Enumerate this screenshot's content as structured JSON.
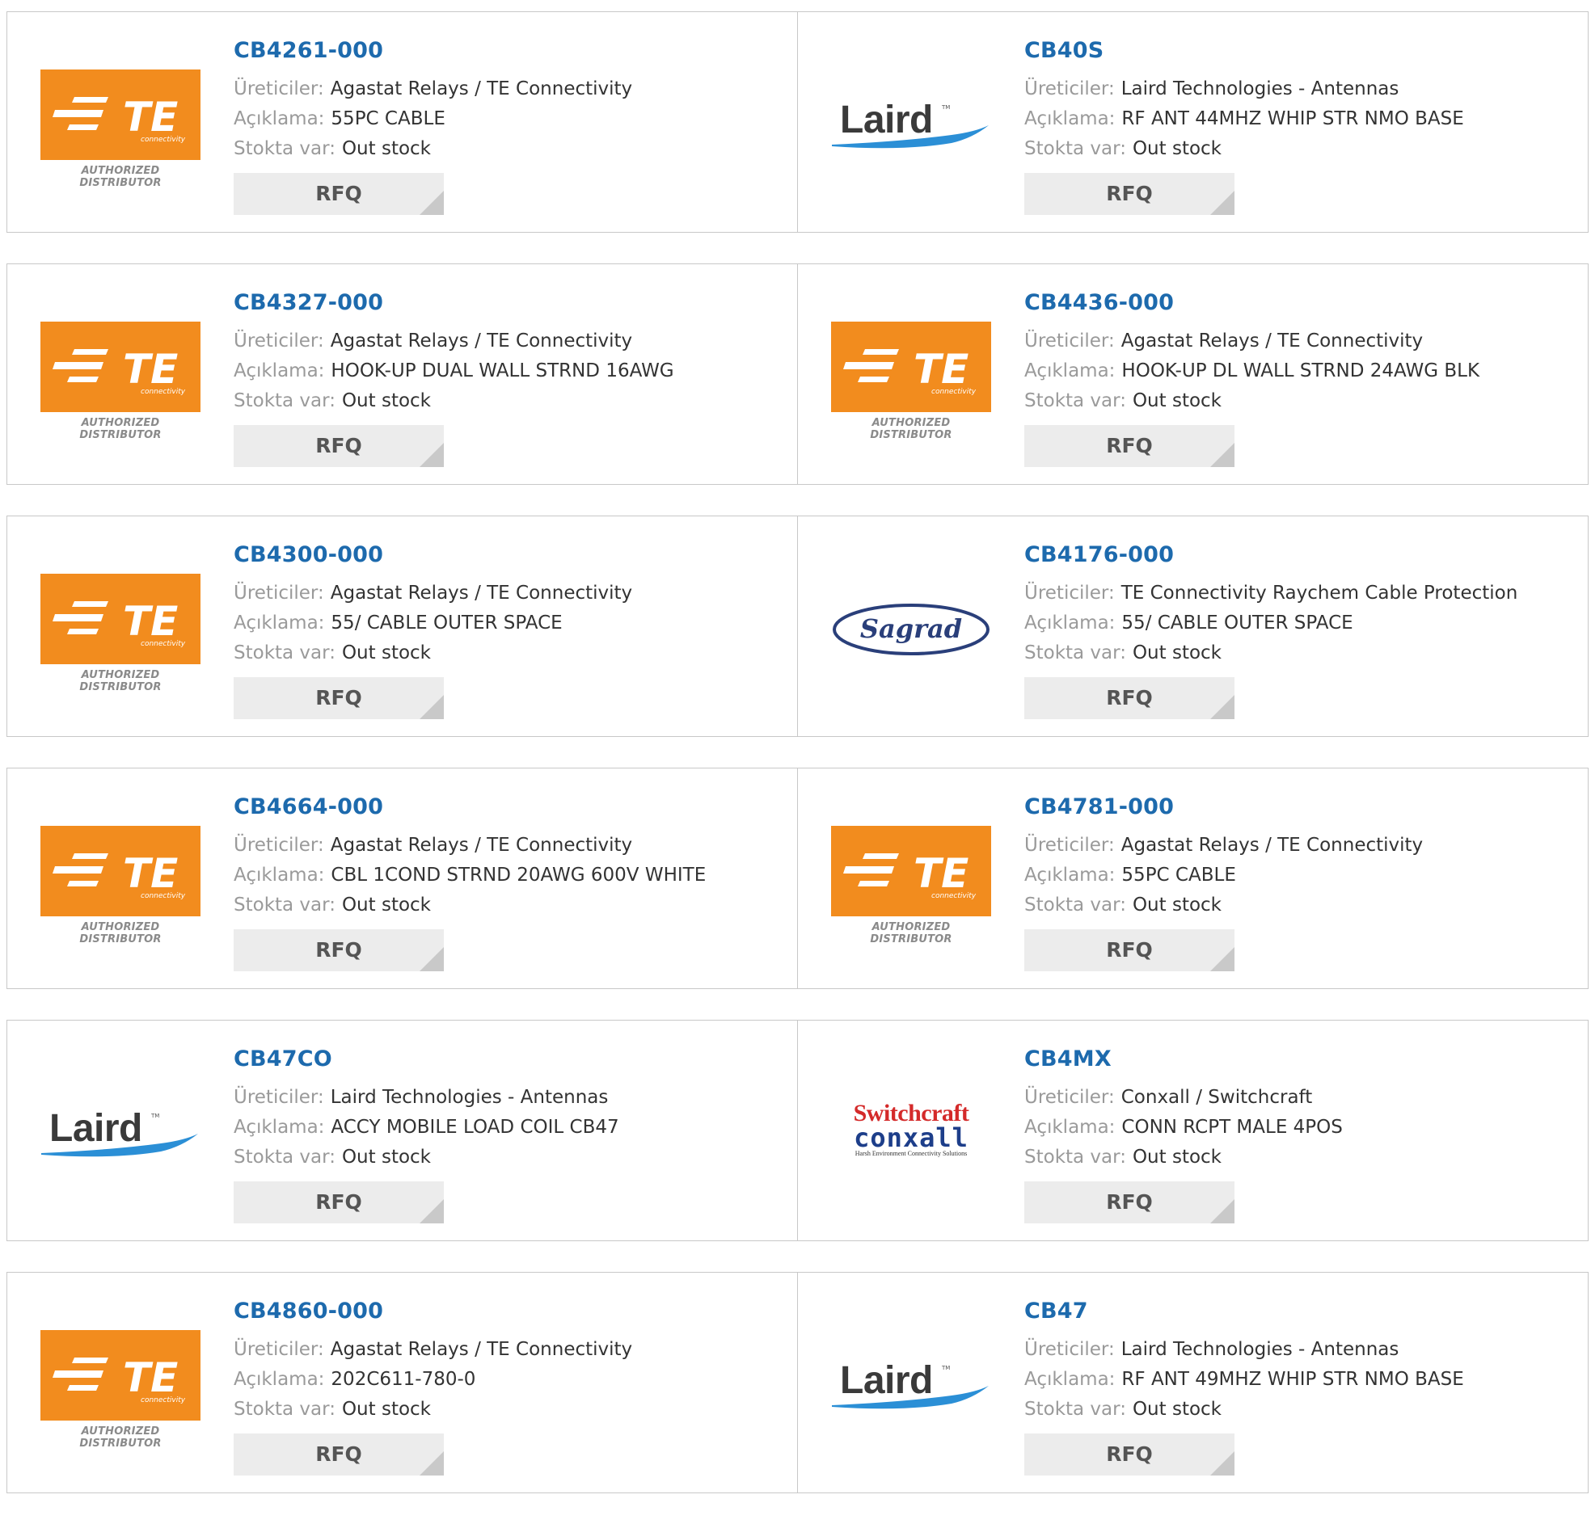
{
  "labels": {
    "manufacturer": "Üreticiler:",
    "description": "Açıklama:",
    "stock": "Stokta var:",
    "rfq": "RFQ"
  },
  "logo_text": {
    "te_brand": "TE",
    "te_sub": "connectivity",
    "te_authorized": "AUTHORIZED DISTRIBUTOR",
    "laird": "Laird",
    "laird_tm": "TM",
    "sagrad": "Sagrad",
    "switchcraft": "Switchcraft",
    "conxall": "conxall",
    "conxall_sub": "Harsh Environment Connectivity Solutions"
  },
  "colors": {
    "part_link": "#1d6aad",
    "te_orange": "#f28c1e",
    "laird_swoosh": "#2b8fd6",
    "sagrad_blue": "#2a3f7a",
    "switchcraft_red": "#d42a2a",
    "conxall_blue": "#1d3e8a"
  },
  "products": [
    {
      "part": "CB4261-000",
      "manufacturer": "Agastat Relays / TE Connectivity",
      "description": "55PC CABLE",
      "stock": "Out stock",
      "logo": "te"
    },
    {
      "part": "CB40S",
      "manufacturer": "Laird Technologies - Antennas",
      "description": "RF ANT 44MHZ WHIP STR NMO BASE",
      "stock": "Out stock",
      "logo": "laird"
    },
    {
      "part": "CB4327-000",
      "manufacturer": "Agastat Relays / TE Connectivity",
      "description": "HOOK-UP DUAL WALL STRND 16AWG",
      "stock": "Out stock",
      "logo": "te"
    },
    {
      "part": "CB4436-000",
      "manufacturer": "Agastat Relays / TE Connectivity",
      "description": "HOOK-UP DL WALL STRND 24AWG BLK",
      "stock": "Out stock",
      "logo": "te"
    },
    {
      "part": "CB4300-000",
      "manufacturer": "Agastat Relays / TE Connectivity",
      "description": "55/ CABLE OUTER SPACE",
      "stock": "Out stock",
      "logo": "te"
    },
    {
      "part": "CB4176-000",
      "manufacturer": "TE Connectivity Raychem Cable Protection",
      "description": "55/ CABLE OUTER SPACE",
      "stock": "Out stock",
      "logo": "sagrad"
    },
    {
      "part": "CB4664-000",
      "manufacturer": "Agastat Relays / TE Connectivity",
      "description": "CBL 1COND STRND 20AWG 600V WHITE",
      "stock": "Out stock",
      "logo": "te"
    },
    {
      "part": "CB4781-000",
      "manufacturer": "Agastat Relays / TE Connectivity",
      "description": "55PC CABLE",
      "stock": "Out stock",
      "logo": "te"
    },
    {
      "part": "CB47CO",
      "manufacturer": "Laird Technologies - Antennas",
      "description": "ACCY MOBILE LOAD COIL CB47",
      "stock": "Out stock",
      "logo": "laird"
    },
    {
      "part": "CB4MX",
      "manufacturer": "Conxall / Switchcraft",
      "description": "CONN RCPT MALE 4POS",
      "stock": "Out stock",
      "logo": "switchcraft"
    },
    {
      "part": "CB4860-000",
      "manufacturer": "Agastat Relays / TE Connectivity",
      "description": "202C611-780-0",
      "stock": "Out stock",
      "logo": "te"
    },
    {
      "part": "CB47",
      "manufacturer": "Laird Technologies - Antennas",
      "description": "RF ANT 49MHZ WHIP STR NMO BASE",
      "stock": "Out stock",
      "logo": "laird"
    }
  ]
}
